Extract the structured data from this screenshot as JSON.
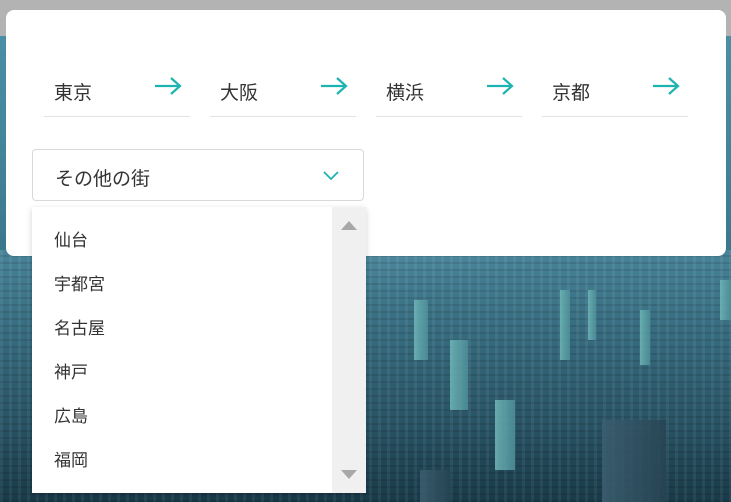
{
  "colors": {
    "accent": "#1db3b0",
    "text": "#333333",
    "card_bg": "#ffffff",
    "scrollbar_bg": "#f0f0f0"
  },
  "cities": [
    {
      "label": "東京",
      "icon": "arrow-right-icon"
    },
    {
      "label": "大阪",
      "icon": "arrow-right-icon"
    },
    {
      "label": "横浜",
      "icon": "arrow-right-icon"
    },
    {
      "label": "京都",
      "icon": "arrow-right-icon"
    }
  ],
  "select": {
    "value": "その他の街",
    "icon": "chevron-down-icon"
  },
  "dropdown": {
    "options": [
      "仙台",
      "宇都宮",
      "名古屋",
      "神戸",
      "広島",
      "福岡"
    ]
  }
}
